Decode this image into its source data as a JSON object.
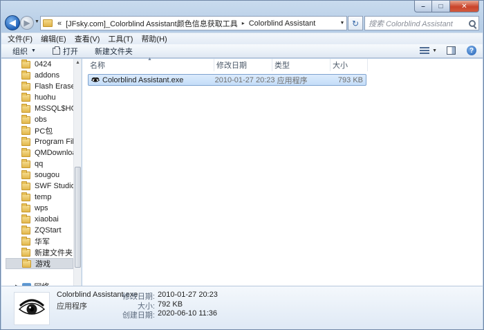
{
  "window": {
    "buttons": [
      "minimize",
      "maximize",
      "close"
    ]
  },
  "address_bar": {
    "overflow_marker": "«",
    "crumbs": [
      "[JFsky.com]_Colorblind Assistant颜色信息获取工具",
      "Colorblind Assistant"
    ],
    "separator": "▸",
    "search_placeholder": "搜索 Colorblind Assistant"
  },
  "menu": {
    "items": [
      "文件(F)",
      "编辑(E)",
      "查看(V)",
      "工具(T)",
      "帮助(H)"
    ]
  },
  "toolbar": {
    "organize": "组织",
    "open": "打开",
    "new_folder": "新建文件夹"
  },
  "nav_pane": {
    "folders": [
      "0424",
      "addons",
      "Flash Eraser",
      "huohu",
      "MSSQL$HOME",
      "obs",
      "PC包",
      "Program Files",
      "QMDownload",
      "qq",
      "sougou",
      "SWF Studio",
      "temp",
      "wps",
      "xiaobai",
      "ZQStart",
      "华军",
      "新建文件夹",
      "游戏"
    ],
    "selected": "游戏",
    "network_label": "网络"
  },
  "columns": {
    "name": "名称",
    "date": "修改日期",
    "type": "类型",
    "size": "大小"
  },
  "files": [
    {
      "name": "Colorblind Assistant.exe",
      "date": "2010-01-27 20:23",
      "type": "应用程序",
      "size": "793 KB",
      "icon": "eye-icon"
    }
  ],
  "details": {
    "file_name": "Colorblind Assistant.exe",
    "file_type": "应用程序",
    "modified_label": "修改日期:",
    "modified_value": "2010-01-27 20:23",
    "size_label": "大小:",
    "size_value": "792 KB",
    "created_label": "创建日期:",
    "created_value": "2020-06-10 11:36"
  },
  "colors": {
    "selection_bg": "#c4ddf8",
    "selection_border": "#7da2ce",
    "frame": "#b6cde6"
  }
}
